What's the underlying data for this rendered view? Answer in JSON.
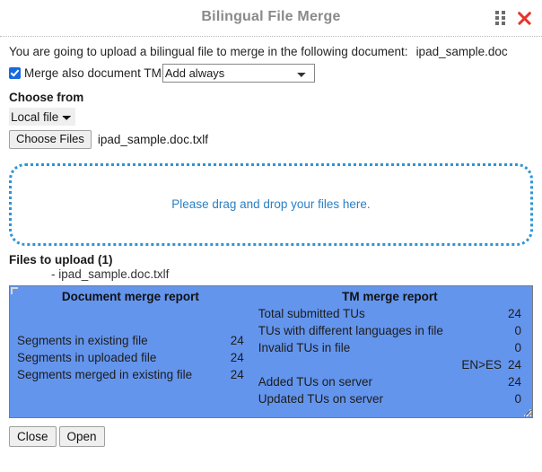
{
  "window": {
    "title": "Bilingual File Merge",
    "drag_handle_icon": "drag-dots-icon",
    "close_icon": "close-x-icon"
  },
  "intro": {
    "text": "You are going to upload a bilingual file to merge in the following document:",
    "document_name": "ipad_sample.doc"
  },
  "merge_tm": {
    "checkbox_checked": true,
    "label": "Merge also document TM",
    "selected_option": "Add always",
    "options": [
      "Add always"
    ]
  },
  "choose_from": {
    "heading": "Choose from",
    "selected_source": "Local file",
    "options": [
      "Local file"
    ],
    "choose_files_label": "Choose Files",
    "chosen_file": "ipad_sample.doc.txlf"
  },
  "dropzone": {
    "text": "Please drag and drop your files here.",
    "border_color": "#2c95d6",
    "text_color": "#2b7fc4"
  },
  "files_to_upload": {
    "heading": "Files to upload (1)",
    "items": [
      "- ipad_sample.doc.txlf"
    ]
  },
  "report": {
    "background_color": "#6495ED",
    "document_merge": {
      "title": "Document merge report",
      "rows": [
        {
          "label": "Segments in existing file",
          "value": "24"
        },
        {
          "label": "Segments in uploaded file",
          "value": "24"
        },
        {
          "label": "Segments merged in existing file",
          "value": "24"
        }
      ]
    },
    "tm_merge": {
      "title": "TM merge report",
      "rows": [
        {
          "label": "Total submitted TUs",
          "value": "24"
        },
        {
          "label": "TUs with different languages in file",
          "value": "0"
        },
        {
          "label": "Invalid TUs in file",
          "value": "0"
        },
        {
          "label": "EN>ES",
          "value": "24"
        },
        {
          "label": "Added TUs on server",
          "value": "24"
        },
        {
          "label": "Updated TUs on server",
          "value": "0"
        }
      ]
    }
  },
  "footer": {
    "close_label": "Close",
    "open_label": "Open"
  }
}
